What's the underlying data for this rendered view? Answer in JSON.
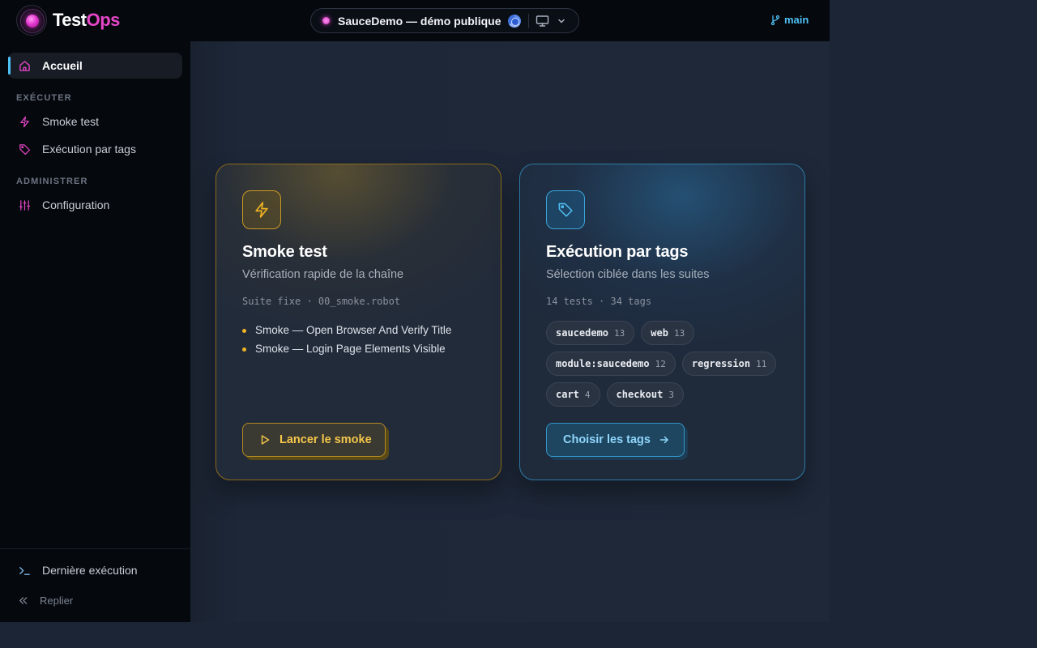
{
  "brand": {
    "name_part1": "Test",
    "name_part2": "Ops"
  },
  "project": {
    "title": "SauceDemo — démo publique",
    "browser_icon": "chrome-icon",
    "device_icon": "monitor-icon"
  },
  "branch": {
    "name": "main"
  },
  "sidebar": {
    "home": {
      "label": "Accueil",
      "icon": "home-icon"
    },
    "section_execute": "EXÉCUTER",
    "smoke": {
      "label": "Smoke test",
      "icon": "lightning-icon"
    },
    "tags": {
      "label": "Exécution par tags",
      "icon": "tag-icon"
    },
    "section_admin": "ADMINISTRER",
    "config": {
      "label": "Configuration",
      "icon": "sliders-icon"
    },
    "last_run": {
      "label": "Dernière exécution",
      "icon": "terminal-icon"
    },
    "collapse": {
      "label": "Replier",
      "icon": "double-chevron-left-icon"
    }
  },
  "cards": {
    "smoke": {
      "title": "Smoke test",
      "subtitle": "Vérification rapide de la chaîne",
      "meta": "Suite fixe · 00_smoke.robot",
      "tests": [
        "Smoke — Open Browser And Verify Title",
        "Smoke — Login Page Elements Visible"
      ],
      "button": "Lancer le smoke"
    },
    "tags": {
      "title": "Exécution par tags",
      "subtitle": "Sélection ciblée dans les suites",
      "meta": "14 tests · 34 tags",
      "chips": [
        {
          "name": "saucedemo",
          "count": "13"
        },
        {
          "name": "web",
          "count": "13"
        },
        {
          "name": "module:saucedemo",
          "count": "12"
        },
        {
          "name": "regression",
          "count": "11"
        },
        {
          "name": "cart",
          "count": "4"
        },
        {
          "name": "checkout",
          "count": "3"
        }
      ],
      "button": "Choisir les tags"
    }
  },
  "colors": {
    "accent_magenta": "#e646c8",
    "accent_blue": "#4fc1f5",
    "smoke_gold": "#f0b323",
    "sidebar_bg": "#05080d",
    "main_bg": "#1e2839"
  }
}
